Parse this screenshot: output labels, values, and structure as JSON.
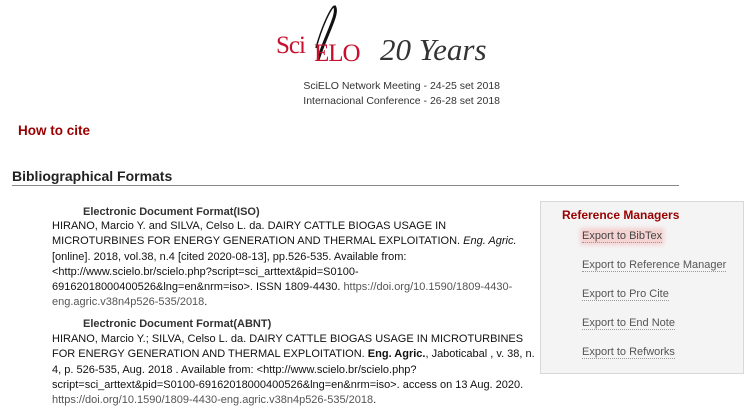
{
  "banner": {
    "brand_sci": "Sci",
    "brand_elo": "ELO",
    "years": "20 Years",
    "line1": "SciELO Network Meeting - 24-25 set 2018",
    "line2": "Internacional Conference - 26-28 set 2018"
  },
  "how_to_cite": "How to cite",
  "section_title": "Bibliographical Formats",
  "iso": {
    "heading": "Electronic Document Format(ISO)",
    "authors": "HIRANO, Marcio Y.  and  SILVA, Celso L. da. DAIRY CATTLE BIOGAS USAGE IN MICROTURBINES FOR ENERGY GENERATION AND THERMAL EXPLOITATION. ",
    "journal": "Eng. Agric.",
    "rest": " [online]. 2018, vol.38, n.4 [cited  2020-08-13], pp.526-535. Available from: <http://www.scielo.br/scielo.php?script=sci_arttext&pid=S0100-69162018000400526&lng=en&nrm=iso>. ISSN 1809-4430.  ",
    "doi": "https://doi.org/10.1590/1809-4430-eng.agric.v38n4p526-535/2018",
    "end": "."
  },
  "abnt": {
    "heading": "Electronic Document Format(ABNT)",
    "authors": "HIRANO, Marcio Y.; SILVA, Celso L. da. DAIRY CATTLE BIOGAS USAGE IN MICROTURBINES FOR ENERGY GENERATION AND THERMAL EXPLOITATION. ",
    "journal": "Eng. Agric.",
    "rest": ",  Jaboticabal ,  v. 38, n. 4, p. 526-535,  Aug.  2018 .   Available from: <http://www.scielo.br/scielo.php?script=sci_arttext&pid=S0100-69162018000400526&lng=en&nrm=iso>. access on  13  Aug.  2020.  ",
    "doi": "https://doi.org/10.1590/1809-4430-eng.agric.v38n4p526-535/2018",
    "end": "."
  },
  "reference_managers": {
    "title": "Reference Managers",
    "links": [
      "Export to BibTex",
      "Export to Reference Manager",
      "Export to Pro Cite",
      "Export to End Note",
      "Export to Refworks"
    ]
  },
  "colors": {
    "accent": "#990000",
    "logo_red": "#c8102e",
    "highlight": "#f5d3d3"
  }
}
